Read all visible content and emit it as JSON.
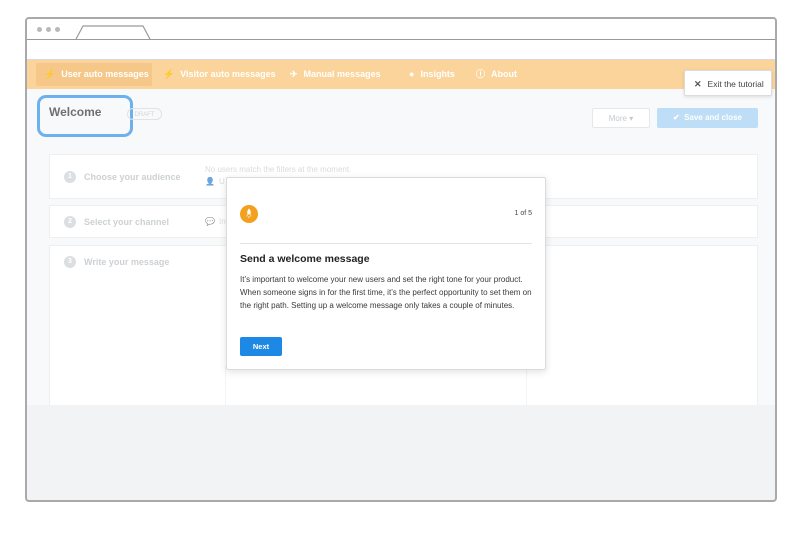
{
  "nav": {
    "items": [
      {
        "label": "User auto messages",
        "icon": "lightning-icon"
      },
      {
        "label": "Visitor auto messages",
        "icon": "lightning-icon"
      },
      {
        "label": "Manual messages",
        "icon": "paper-plane-icon"
      },
      {
        "label": "Insights",
        "icon": "bulb-icon"
      },
      {
        "label": "About",
        "icon": "info-icon"
      }
    ]
  },
  "exit_tutorial": {
    "label": "Exit the tutorial"
  },
  "header": {
    "title": "Welcome",
    "status": "DRAFT",
    "more_label": "More",
    "save_label": "Save and close"
  },
  "steps": [
    {
      "number": "1",
      "label": "Choose your audience",
      "detail": "No users match the filters at the moment.",
      "sub": "U"
    },
    {
      "number": "2",
      "label": "Select your channel",
      "detail": "In"
    },
    {
      "number": "3",
      "label": "Write your message"
    }
  ],
  "popover": {
    "step_counter": "1 of 5",
    "title": "Send a welcome message",
    "body": "It’s important to welcome your new users and set the right tone for your product. When someone signs in for the first time, it’s the perfect opportunity to set them on the right path. Setting up a welcome message only takes a couple of minutes.",
    "next_label": "Next"
  },
  "colors": {
    "nav_background": "#fad49a",
    "highlight_ring": "#1e88e5",
    "primary_button": "#1e88e5",
    "save_button": "#9ccbf2",
    "popover_icon": "#f2a01e"
  }
}
